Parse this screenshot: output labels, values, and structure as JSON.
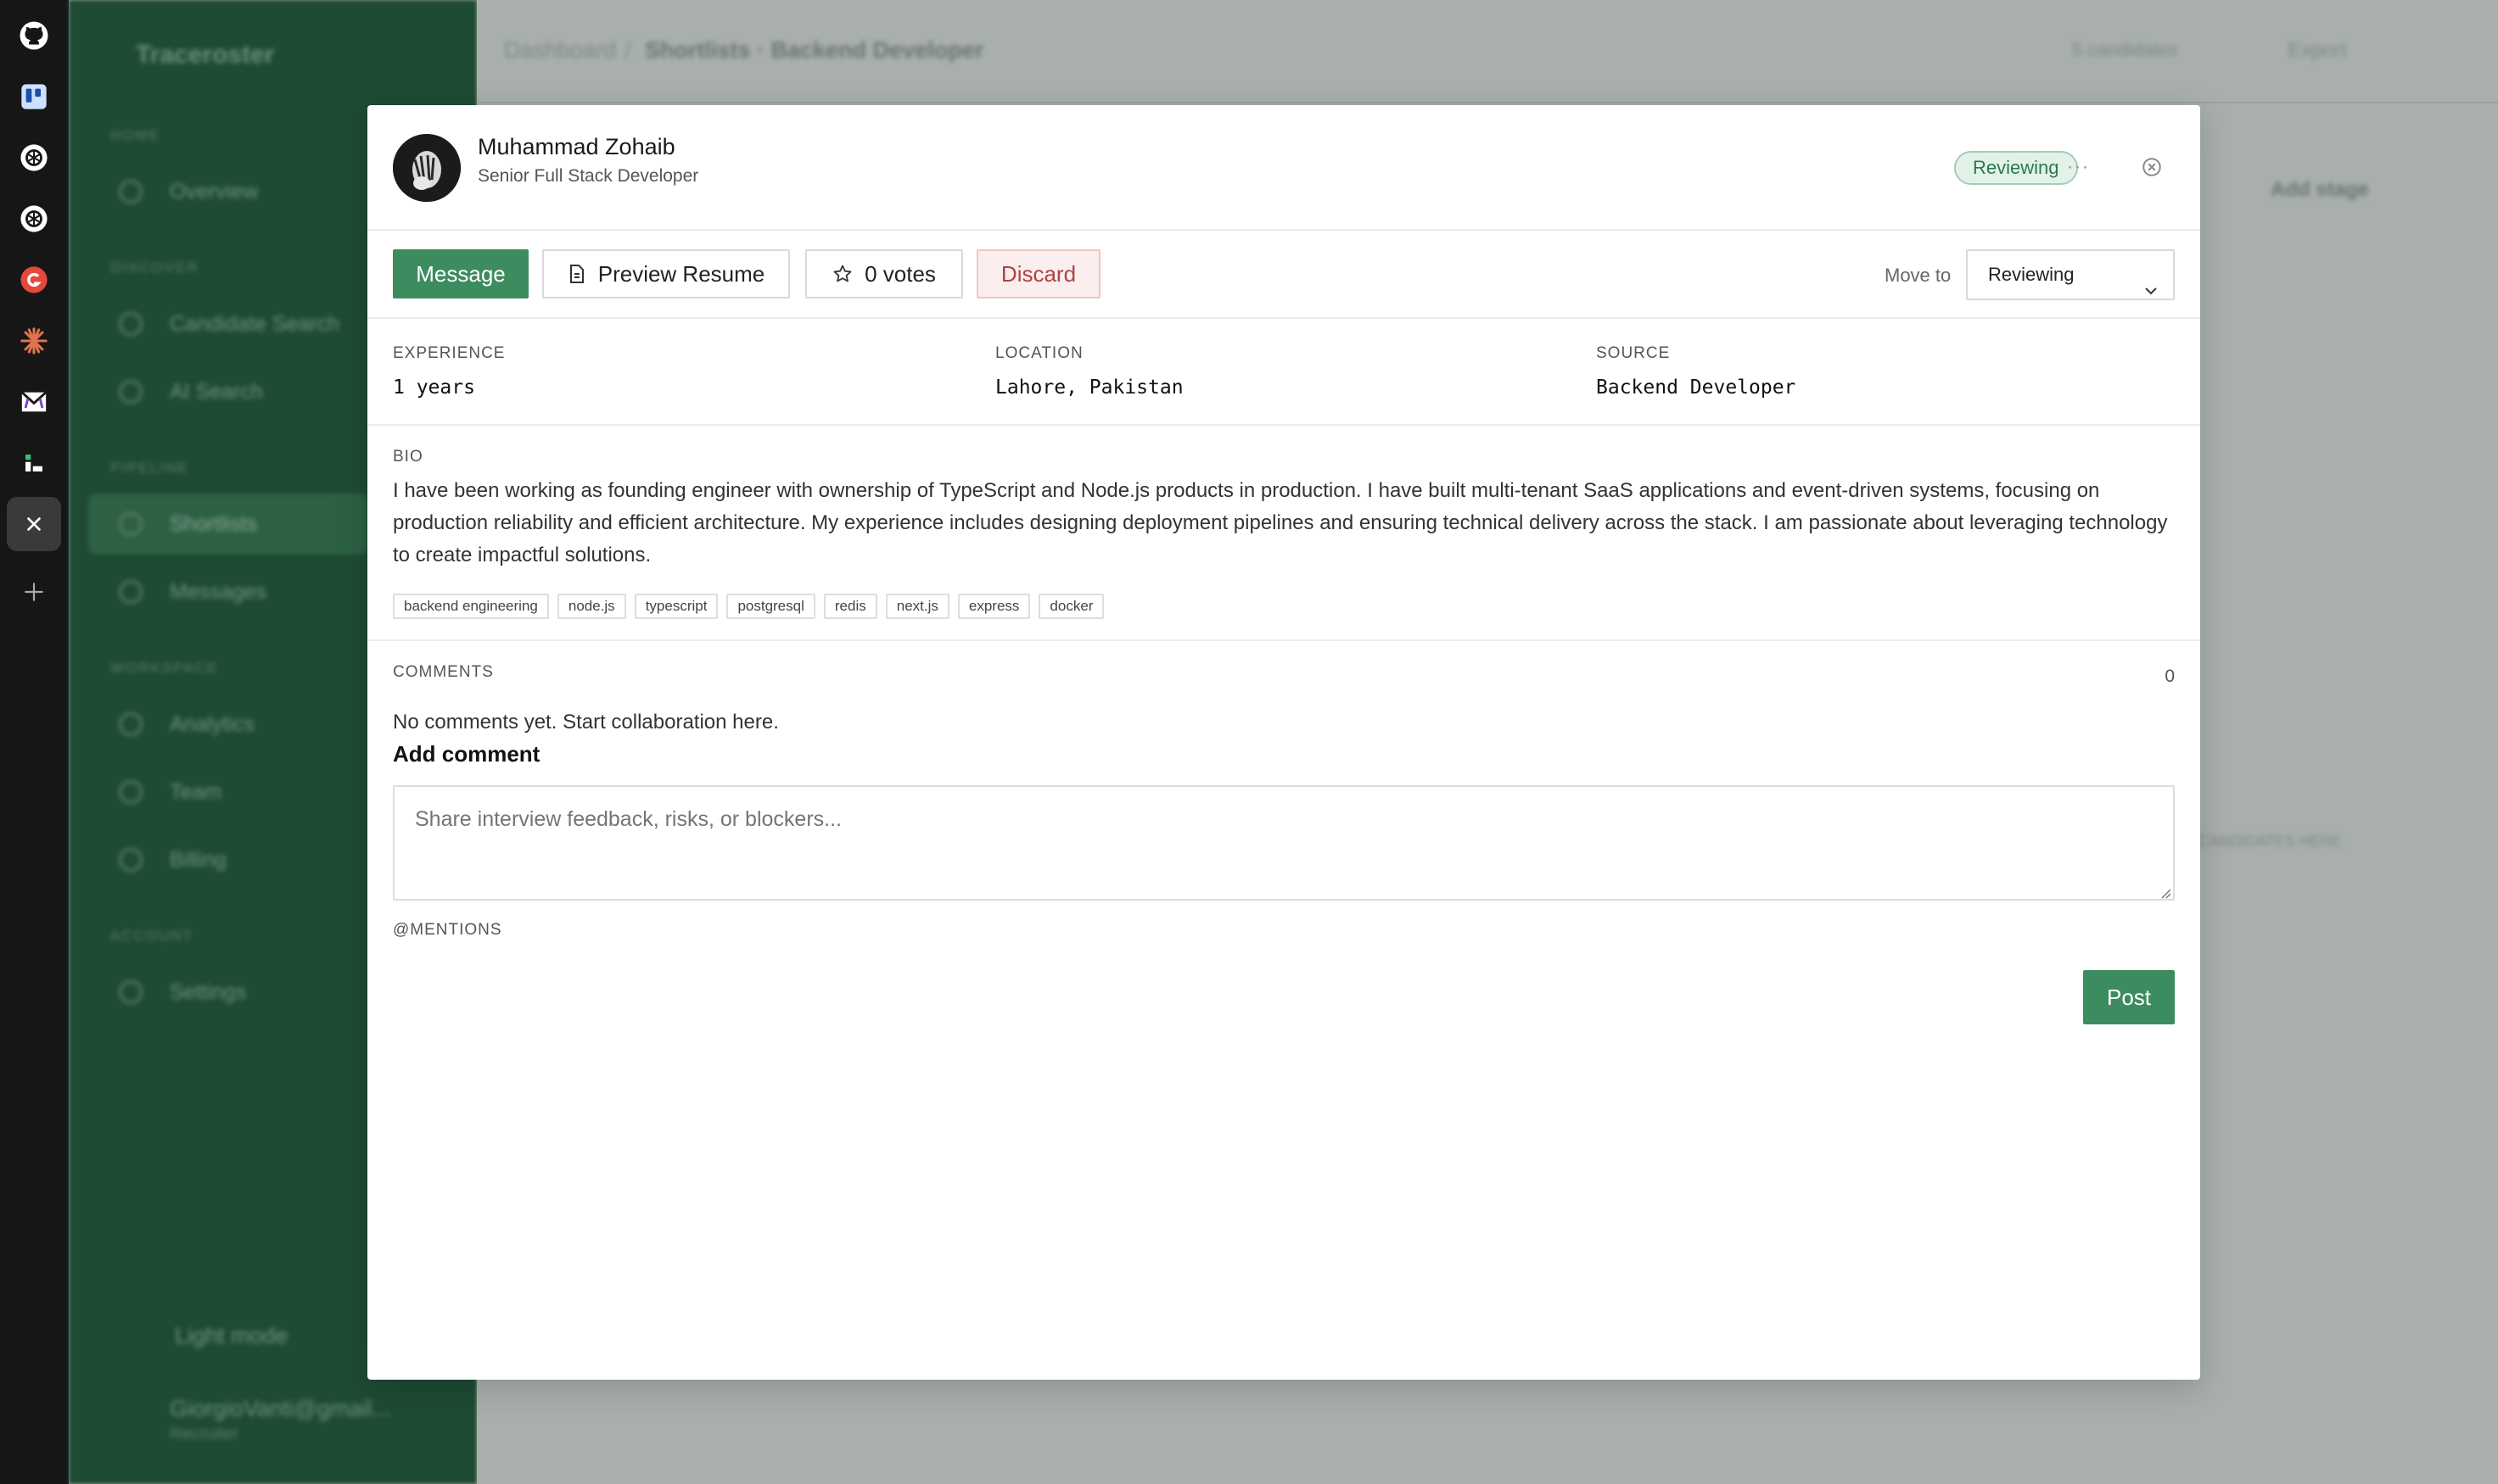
{
  "dock": {
    "items": [
      {
        "name": "github-icon"
      },
      {
        "name": "trello-icon"
      },
      {
        "name": "chatgpt-icon"
      },
      {
        "name": "chatgpt-icon-2"
      },
      {
        "name": "grammarly-icon"
      },
      {
        "name": "claude-icon"
      },
      {
        "name": "mail-icon"
      },
      {
        "name": "app-icon"
      },
      {
        "name": "close-app-icon"
      },
      {
        "name": "add-app-icon"
      }
    ]
  },
  "background": {
    "brand": "Traceroster",
    "sections": [
      "HOME",
      "DISCOVER",
      "PIPELINE",
      "WORKSPACE",
      "ACCOUNT"
    ],
    "nav": [
      "Overview",
      "Candidate Search",
      "AI Search",
      "Shortlists",
      "Messages",
      "Analytics",
      "Team",
      "Billing",
      "Settings"
    ],
    "theme_toggle": "Light mode",
    "user_email": "GiorgioVanti@gmail...",
    "user_role": "Recruiter",
    "breadcrumb_root": "Dashboard",
    "breadcrumb_sep": "/",
    "breadcrumb_current": "Shortlists · Backend Developer",
    "candidate_count": "5 candidates",
    "export": "Export",
    "add_stage": "Add stage",
    "candidates_here": "CANDIDATES HERE"
  },
  "candidate": {
    "name": "Muhammad Zohaib",
    "title": "Senior Full Stack Developer",
    "status": "Reviewing"
  },
  "actions": {
    "message": "Message",
    "preview_resume": "Preview Resume",
    "votes": "0 votes",
    "discard": "Discard",
    "move_to_label": "Move to",
    "move_to_value": "Reviewing"
  },
  "info": {
    "experience_label": "EXPERIENCE",
    "experience_value": "1 years",
    "location_label": "LOCATION",
    "location_value": "Lahore, Pakistan",
    "source_label": "SOURCE",
    "source_value": "Backend Developer"
  },
  "bio": {
    "label": "BIO",
    "text": "I have been working as founding engineer with ownership of TypeScript and Node.js products in production. I have built multi-tenant SaaS applications and event-driven systems, focusing on production reliability and efficient architecture. My experience includes designing deployment pipelines and ensuring technical delivery across the stack. I am passionate about leveraging technology to create impactful solutions.",
    "tags": [
      "backend engineering",
      "node.js",
      "typescript",
      "postgresql",
      "redis",
      "next.js",
      "express",
      "docker"
    ]
  },
  "comments": {
    "label": "COMMENTS",
    "count": "0",
    "empty_text": "No comments yet. Start collaboration here.",
    "add_title": "Add comment",
    "placeholder": "Share interview feedback, risks, or blockers...",
    "mentions_label": "@MENTIONS",
    "post": "Post"
  },
  "colors": {
    "accent": "#3d8c5f",
    "status_bg": "#e3f2e8",
    "discard": "#b24141",
    "sidebar": "#1e4b33"
  }
}
